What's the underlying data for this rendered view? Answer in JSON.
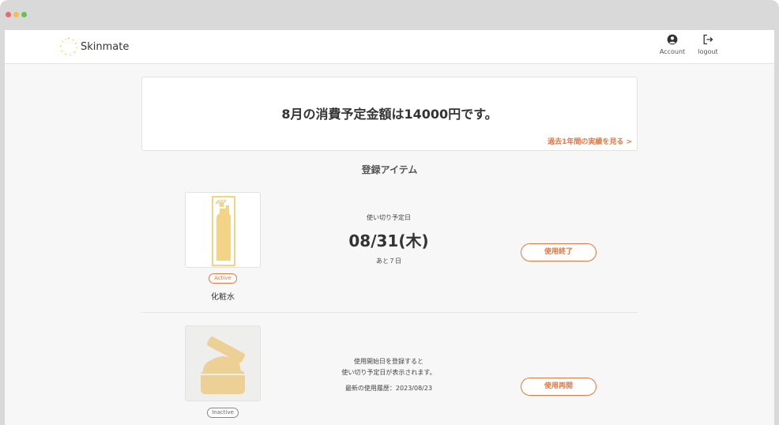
{
  "window": {
    "controls": [
      {
        "name": "close",
        "color": "#ed6a5e"
      },
      {
        "name": "minimize",
        "color": "#f4bf4f"
      },
      {
        "name": "zoom",
        "color": "#61c554"
      }
    ]
  },
  "header": {
    "brand": "Skinmate",
    "nav": [
      {
        "label": "Account",
        "icon": "account-icon"
      },
      {
        "label": "logout",
        "icon": "logout-icon"
      }
    ]
  },
  "budget": {
    "message": "8月の消費予定金額は14000円です。",
    "history_link": "過去1年間の実績を見る >"
  },
  "section_title": "登録アイテム",
  "items": [
    {
      "status": "Active",
      "name": "化粧水",
      "icon": "lotion-bottle-icon",
      "due_label": "使い切り予定日",
      "due_date": "08/31(木)",
      "remaining": "あと７日",
      "action": "使用終了"
    },
    {
      "status": "Inactive",
      "icon": "cream-jar-icon",
      "info_line1": "使用開始日を登録すると",
      "info_line2": "使い切り予定日が表示されます。",
      "last_used": "最新の使用履歴：2023/08/23",
      "action": "使用再開"
    }
  ],
  "colors": {
    "accent": "#e07a49",
    "product": "#f3d386",
    "product_inactive": "#ecd096",
    "background": "#f7f7f7"
  }
}
